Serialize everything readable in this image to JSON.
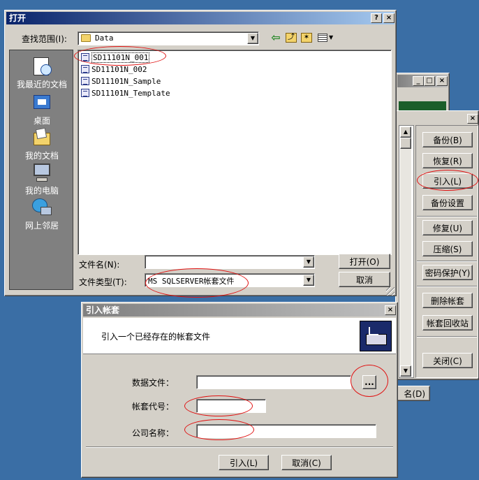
{
  "open_dialog": {
    "title": "打开",
    "look_in_label": "查找范围(I):",
    "look_in_value": "Data",
    "places": [
      {
        "label": "我最近的文档",
        "icon": "recent-documents-icon"
      },
      {
        "label": "桌面",
        "icon": "desktop-icon"
      },
      {
        "label": "我的文档",
        "icon": "my-documents-icon"
      },
      {
        "label": "我的电脑",
        "icon": "my-computer-icon"
      },
      {
        "label": "网上邻居",
        "icon": "network-places-icon"
      }
    ],
    "files": [
      "SD11101N_001",
      "SD11101N_002",
      "SD11101N_Sample",
      "SD11101N_Template"
    ],
    "filename_label": "文件名(N):",
    "filename_value": "",
    "filetype_label": "文件类型(T):",
    "filetype_value": "MS SQLSERVER帐套文件",
    "open_button": "打开(O)",
    "cancel_button": "取消",
    "help_glyph": "?",
    "close_glyph": "×"
  },
  "side_panel": {
    "buttons": [
      "备份(B)",
      "恢复(R)",
      "引入(L)",
      "备份设置",
      "修复(U)",
      "压缩(S)",
      "密码保护(Y)",
      "删除帐套",
      "帐套回收站",
      "关闭(C)"
    ],
    "partial_button": "名(D)"
  },
  "import_dialog": {
    "title": "引入帐套",
    "header_text": "引入一个已经存在的帐套文件",
    "data_file_label": "数据文件：",
    "data_file_value": "",
    "browse_label": "...",
    "code_label": "帐套代号：",
    "code_value": "",
    "company_label": "公司名称：",
    "company_value": "",
    "import_button": "引入(L)",
    "cancel_button": "取消(C)"
  },
  "colors": {
    "desktop": "#3a6ea5",
    "face": "#d4d0c8",
    "active_title": "#0a246a",
    "annotation": "#e01010"
  }
}
